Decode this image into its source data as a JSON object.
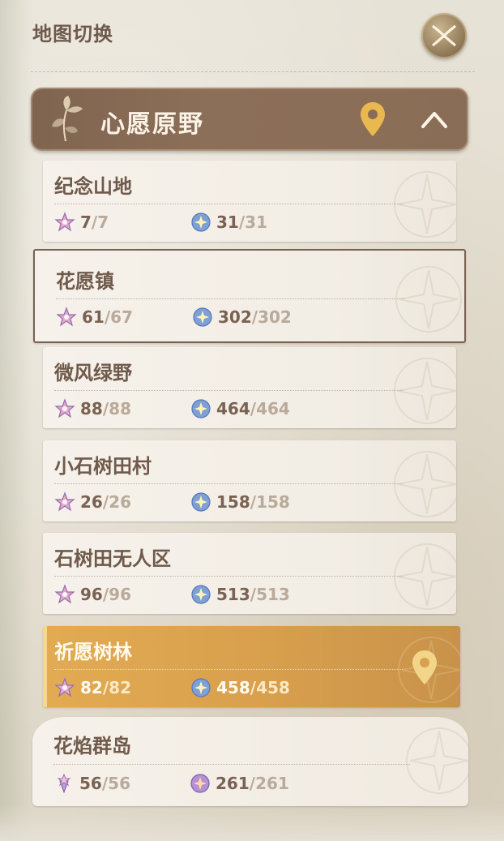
{
  "panel": {
    "title": "地图切换"
  },
  "region": {
    "name": "心愿原野"
  },
  "areas": [
    {
      "name": "纪念山地",
      "stat_a_current": "7",
      "stat_a_total": "7",
      "stat_b_current": "31",
      "stat_b_total": "31"
    },
    {
      "name": "花愿镇",
      "stat_a_current": "61",
      "stat_a_total": "67",
      "stat_b_current": "302",
      "stat_b_total": "302"
    },
    {
      "name": "微风绿野",
      "stat_a_current": "88",
      "stat_a_total": "88",
      "stat_b_current": "464",
      "stat_b_total": "464"
    },
    {
      "name": "小石树田村",
      "stat_a_current": "26",
      "stat_a_total": "26",
      "stat_b_current": "158",
      "stat_b_total": "158"
    },
    {
      "name": "石树田无人区",
      "stat_a_current": "96",
      "stat_a_total": "96",
      "stat_b_current": "513",
      "stat_b_total": "513"
    },
    {
      "name": "祈愿树林",
      "stat_a_current": "82",
      "stat_a_total": "82",
      "stat_b_current": "458",
      "stat_b_total": "458"
    },
    {
      "name": "花焰群岛",
      "stat_a_current": "56",
      "stat_a_total": "56",
      "stat_b_current": "261",
      "stat_b_total": "261"
    }
  ],
  "separator": "/",
  "colors": {
    "header_brown": "#8a6d56",
    "active_gold": "#d9a04d",
    "text_brown": "#6f5a4b",
    "pin_gold": "#e9b84f"
  }
}
